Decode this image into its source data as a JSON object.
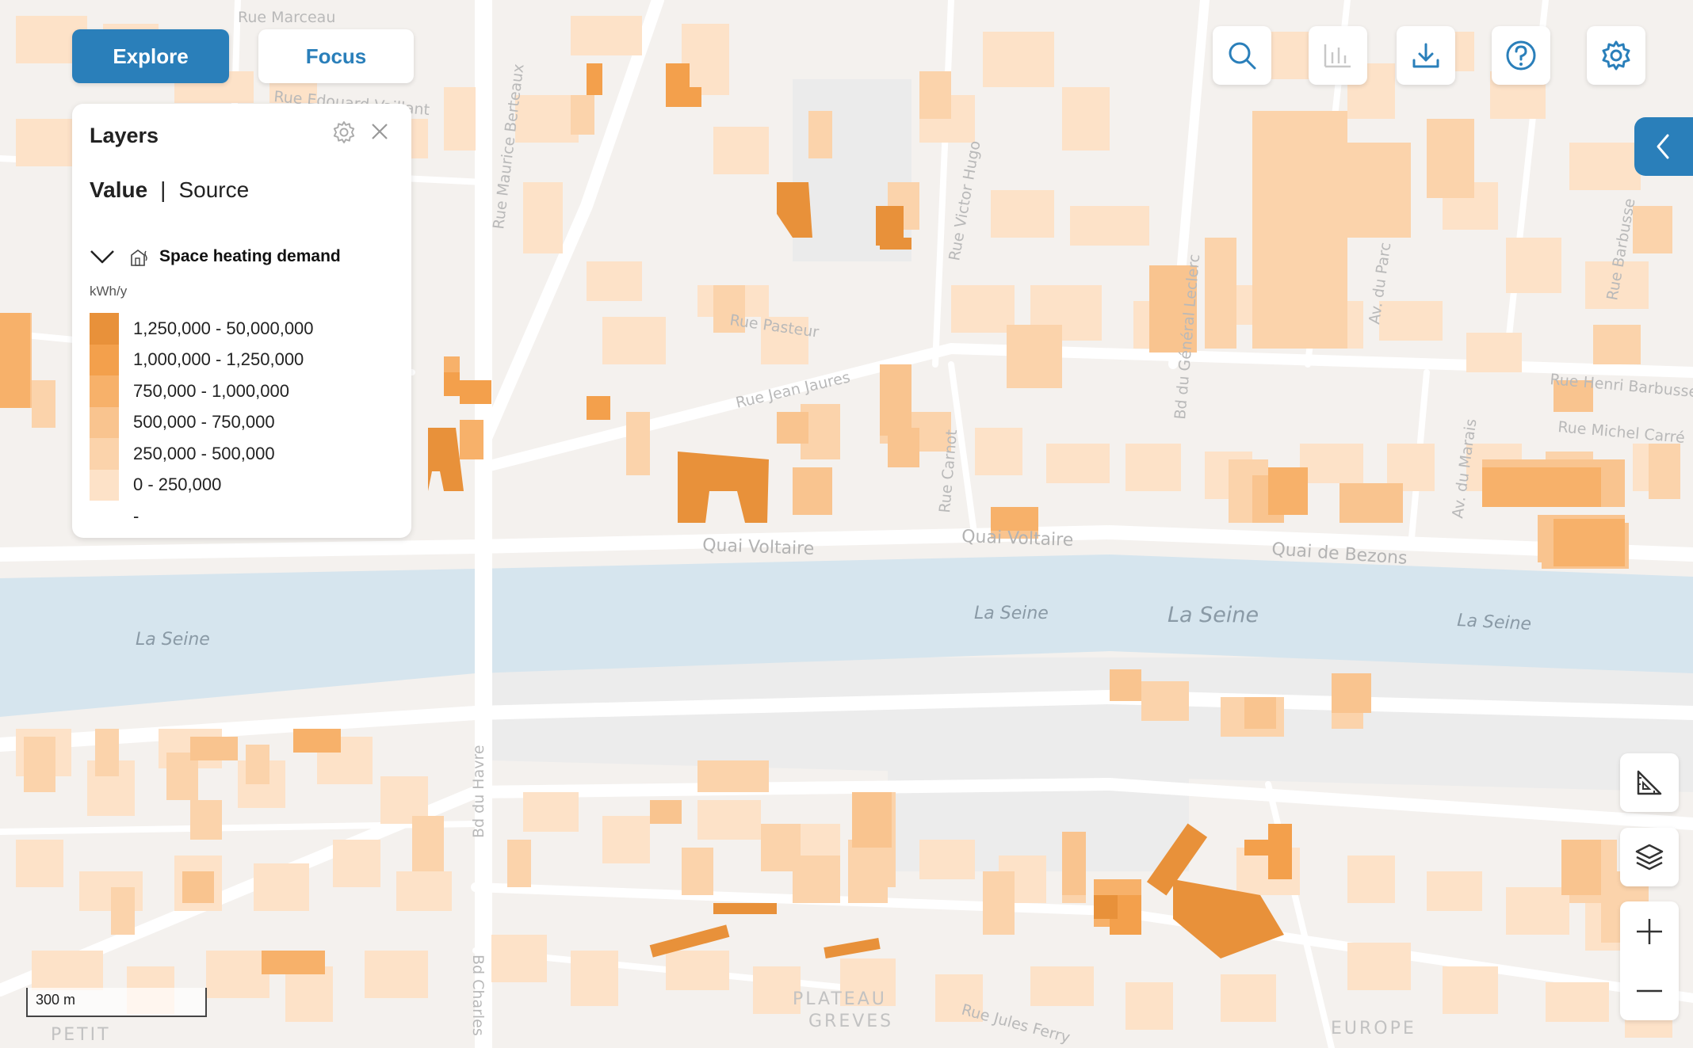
{
  "tabs": {
    "explore_label": "Explore",
    "focus_label": "Focus",
    "active": "Explore"
  },
  "toolbar": {
    "icons": [
      "search-icon",
      "chart-icon",
      "download-icon",
      "help-icon",
      "settings-icon"
    ],
    "chart_enabled": false
  },
  "side_controls": {
    "collapse_icon": "chevron-left-icon",
    "measure_icon": "ruler-triangle-icon",
    "layers_icon": "layers-icon",
    "zoom_in_icon": "plus-icon",
    "zoom_out_icon": "minus-icon"
  },
  "layers_panel": {
    "title": "Layers",
    "mode_value_label": "Value",
    "mode_separator": "|",
    "mode_source_label": "Source",
    "active_mode": "Value",
    "layer": {
      "name": "Space heating demand",
      "icon": "building-heat-icon",
      "expanded": true,
      "unit": "kWh/y",
      "legend": [
        {
          "label": "1,250,000 - 50,000,000",
          "color": "#e8913a"
        },
        {
          "label": "1,000,000 - 1,250,000",
          "color": "#f3a04c"
        },
        {
          "label": "750,000 - 1,000,000",
          "color": "#f7b16a"
        },
        {
          "label": "500,000 - 750,000",
          "color": "#f9c48f"
        },
        {
          "label": "250,000 - 500,000",
          "color": "#fbd3ab"
        },
        {
          "label": "0 - 250,000",
          "color": "#fde2c8"
        },
        {
          "label": "-",
          "color": "#ffffff"
        }
      ]
    }
  },
  "map": {
    "labels": {
      "rue_marceau": "Rue Marceau",
      "rue_edouard_vaillant": "Rue Edouard Vaillant",
      "rue_maurice_berteaux": "Rue Maurice Berteaux",
      "rue_victor_hugo": "Rue Victor Hugo",
      "rue_pasteur": "Rue Pasteur",
      "rue_jean_jaures": "Rue Jean Jaures",
      "bd_general_leclerc": "Bd du Général Leclerc",
      "av_du_parc": "Av. du Parc",
      "rue_barbusse": "Rue Barbusse",
      "rue_henri_barbusse": "Rue Henri Barbusse",
      "rue_michel_carre": "Rue Michel Carré",
      "rue_carnot": "Rue Carnot",
      "av_du_marais": "Av. du Marais",
      "quai_voltaire_1": "Quai Voltaire",
      "quai_voltaire_2": "Quai Voltaire",
      "quai_de_bezons": "Quai de Bezons",
      "la_seine_1": "La Seine",
      "la_seine_2": "La Seine",
      "la_seine_3": "La Seine",
      "la_seine_4": "La Seine",
      "bd_du_havre": "Bd du Havre",
      "bd_charles": "Bd Charles",
      "rue_jules": "Rue Jules Ferry",
      "plateau": "PLATEAU",
      "greves": "GREVES",
      "europe": "EUROPE",
      "petit": "PETIT"
    },
    "colors": {
      "river": "#d6e5ee",
      "land": "#f3f3f3",
      "road": "#ffffff",
      "park": "#e8e8e8"
    }
  },
  "scale": {
    "label": "300 m"
  }
}
